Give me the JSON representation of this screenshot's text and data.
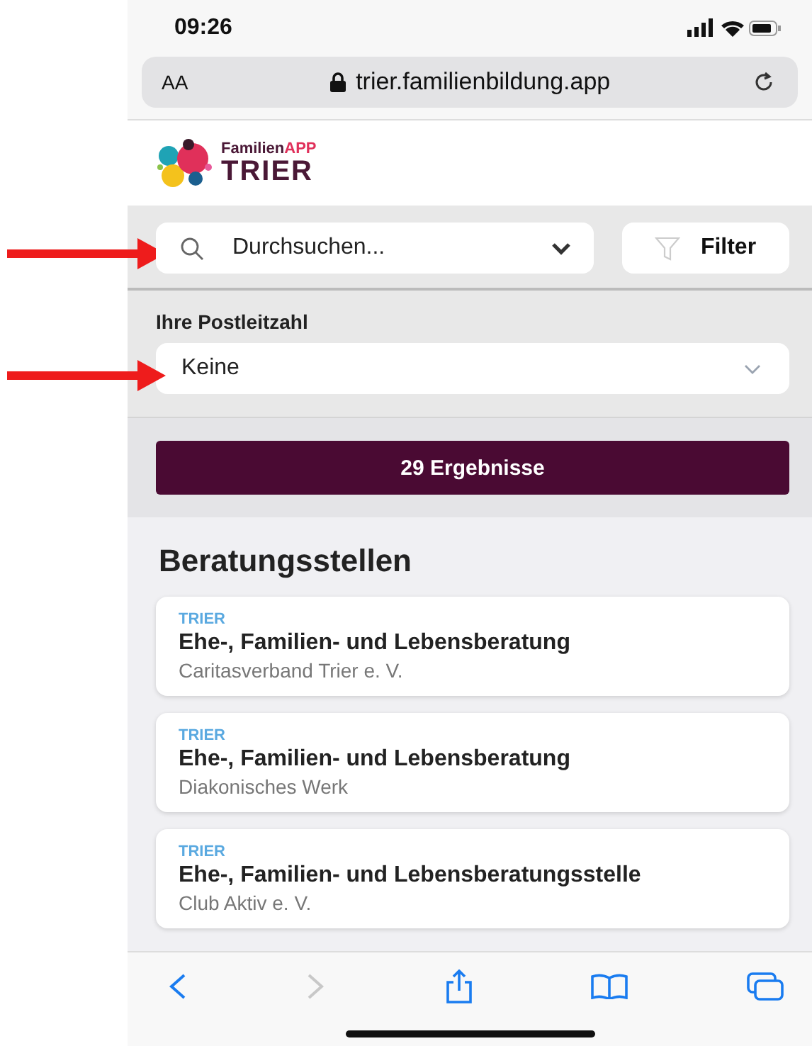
{
  "annotations": [
    {
      "kind": "arrow"
    },
    {
      "kind": "arrow"
    }
  ],
  "status_bar": {
    "time": "09:26"
  },
  "address_bar": {
    "text_size": "AA",
    "url": "trier.familienbildung.app"
  },
  "logo": {
    "prefix": "Familien",
    "accent": "APP",
    "city": "TRIER"
  },
  "search": {
    "placeholder": "Durchsuchen..."
  },
  "filter_button": {
    "label": "Filter"
  },
  "postcode": {
    "label": "Ihre Postleitzahl",
    "value": "Keine"
  },
  "results_button": {
    "label": "29 Ergebnisse"
  },
  "section": {
    "title": "Beratungsstellen"
  },
  "cards": [
    {
      "city": "TRIER",
      "title": "Ehe-, Familien- und Lebensberatung",
      "organization": "Caritasverband Trier e. V."
    },
    {
      "city": "TRIER",
      "title": "Ehe-, Familien- und Lebensberatung",
      "organization": "Diakonisches Werk"
    },
    {
      "city": "TRIER",
      "title": "Ehe-, Familien- und Lebensberatungsstelle",
      "organization": "Club Aktiv e. V."
    }
  ],
  "toolbar": {
    "back_disabled": false,
    "forward_disabled": true
  }
}
